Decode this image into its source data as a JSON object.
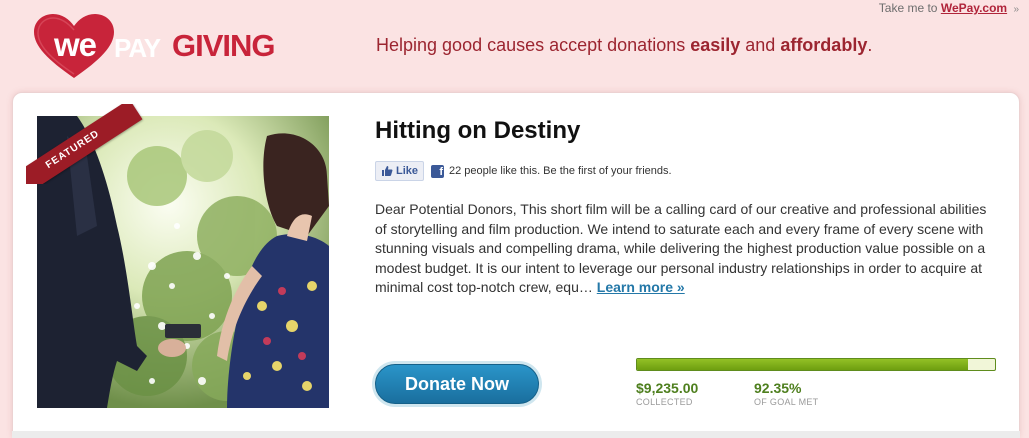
{
  "header": {
    "take_me_prefix": "Take me to",
    "take_me_link": "WePay.com",
    "take_me_arrow": "»",
    "logo": {
      "we": "we",
      "pay": "PAY",
      "giving": "GIVING"
    },
    "tagline": {
      "part1": "Helping good causes accept donations ",
      "easily": "easily",
      "part2": " and ",
      "affordably": "affordably",
      "part3": "."
    }
  },
  "campaign": {
    "featured_label": "FEATURED",
    "title": "Hitting on Destiny",
    "like_button": "Like",
    "like_text": "22 people like this. Be the first of your friends.",
    "description": "Dear Potential Donors, This short film will be a calling card of our creative and professional abilities of storytelling and film production. We intend to saturate each and every frame of every scene with stunning visuals and compelling drama, while delivering the highest production value possible on a modest budget. It is our intent to leverage our personal industry relationships in order to acquire at minimal cost top-notch crew, equ…",
    "learn_more": "Learn more »",
    "donate_button": "Donate Now",
    "progress_fraction": 0.9235,
    "collected_value": "$9,235.00",
    "collected_label": "COLLECTED",
    "goal_value": "92.35%",
    "goal_label": "OF GOAL MET"
  },
  "colors": {
    "background": "#fbe3e3",
    "brand_red": "#c8243a",
    "link_blue": "#2478a8",
    "progress_green": "#7fae1b",
    "donate_blue": "#1f84b7"
  },
  "icons": [
    "heart-logo-icon",
    "facebook-thumb-icon",
    "facebook-icon"
  ]
}
